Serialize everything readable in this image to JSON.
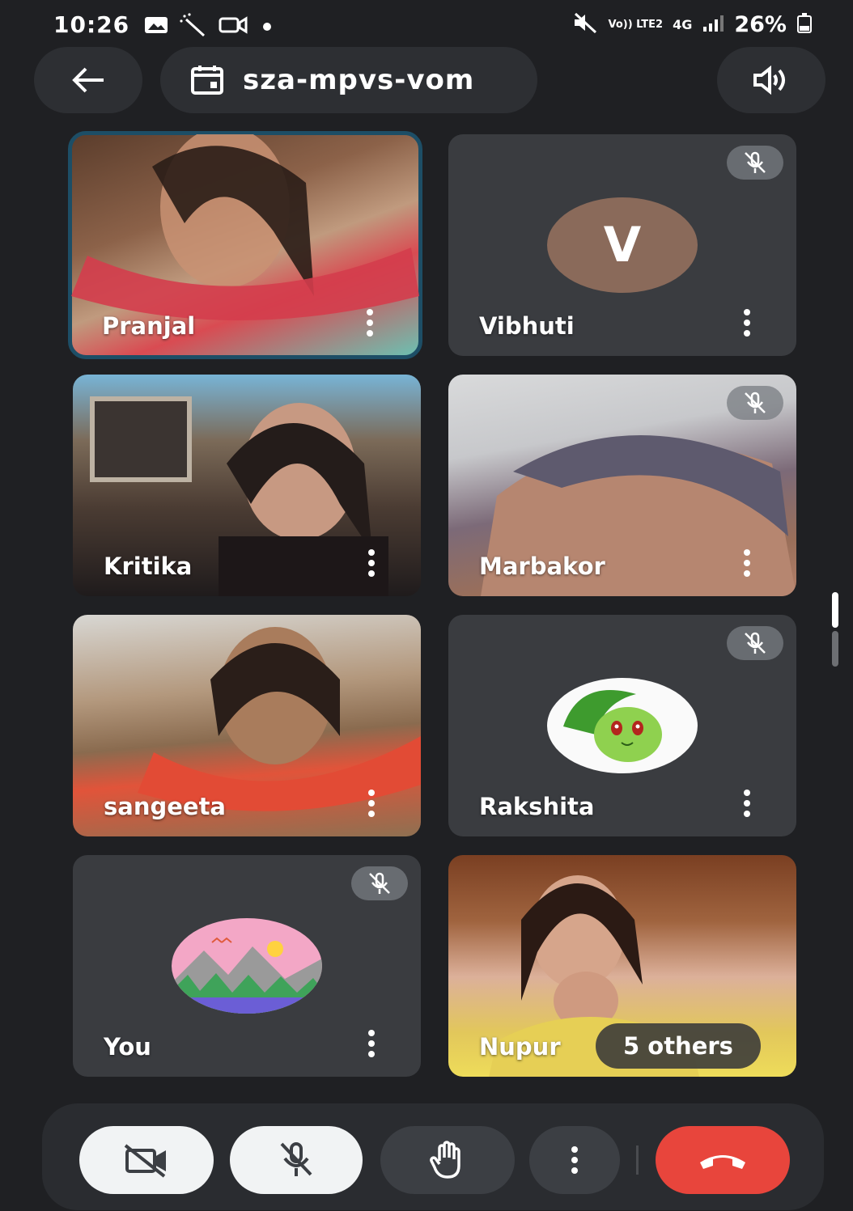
{
  "status_bar": {
    "time": "10:26",
    "network_label": "Vo)) LTE2",
    "network_type": "4G",
    "battery": "26%"
  },
  "top_bar": {
    "meeting_code": "sza-mpvs-vom"
  },
  "participants": [
    {
      "name": "Pranjal",
      "muted": false,
      "video": true,
      "active_speaker": true
    },
    {
      "name": "Vibhuti",
      "muted": true,
      "video": false,
      "avatar_letter": "V",
      "avatar_color": "#8a6a5a"
    },
    {
      "name": "Kritika",
      "muted": false,
      "video": true
    },
    {
      "name": "Marbakor",
      "muted": true,
      "video": true
    },
    {
      "name": "sangeeta",
      "muted": false,
      "video": true
    },
    {
      "name": "Rakshita",
      "muted": true,
      "video": false,
      "avatar": "green-creature-avatar"
    },
    {
      "name": "You",
      "muted": true,
      "video": false,
      "avatar": "mountain-landscape-avatar"
    },
    {
      "name": "Nupur",
      "muted": false,
      "video": true
    }
  ],
  "others_chip": "5 others",
  "controls": {
    "camera": "camera-off-icon",
    "mic": "mic-off-icon",
    "raise_hand": "hand-icon",
    "more": "more-vert-icon",
    "end_call": "call-end-icon"
  },
  "colors": {
    "background": "#1f2023",
    "tile": "#3a3c40",
    "end_call": "#e8453c",
    "active_border": "#1d4e66"
  }
}
